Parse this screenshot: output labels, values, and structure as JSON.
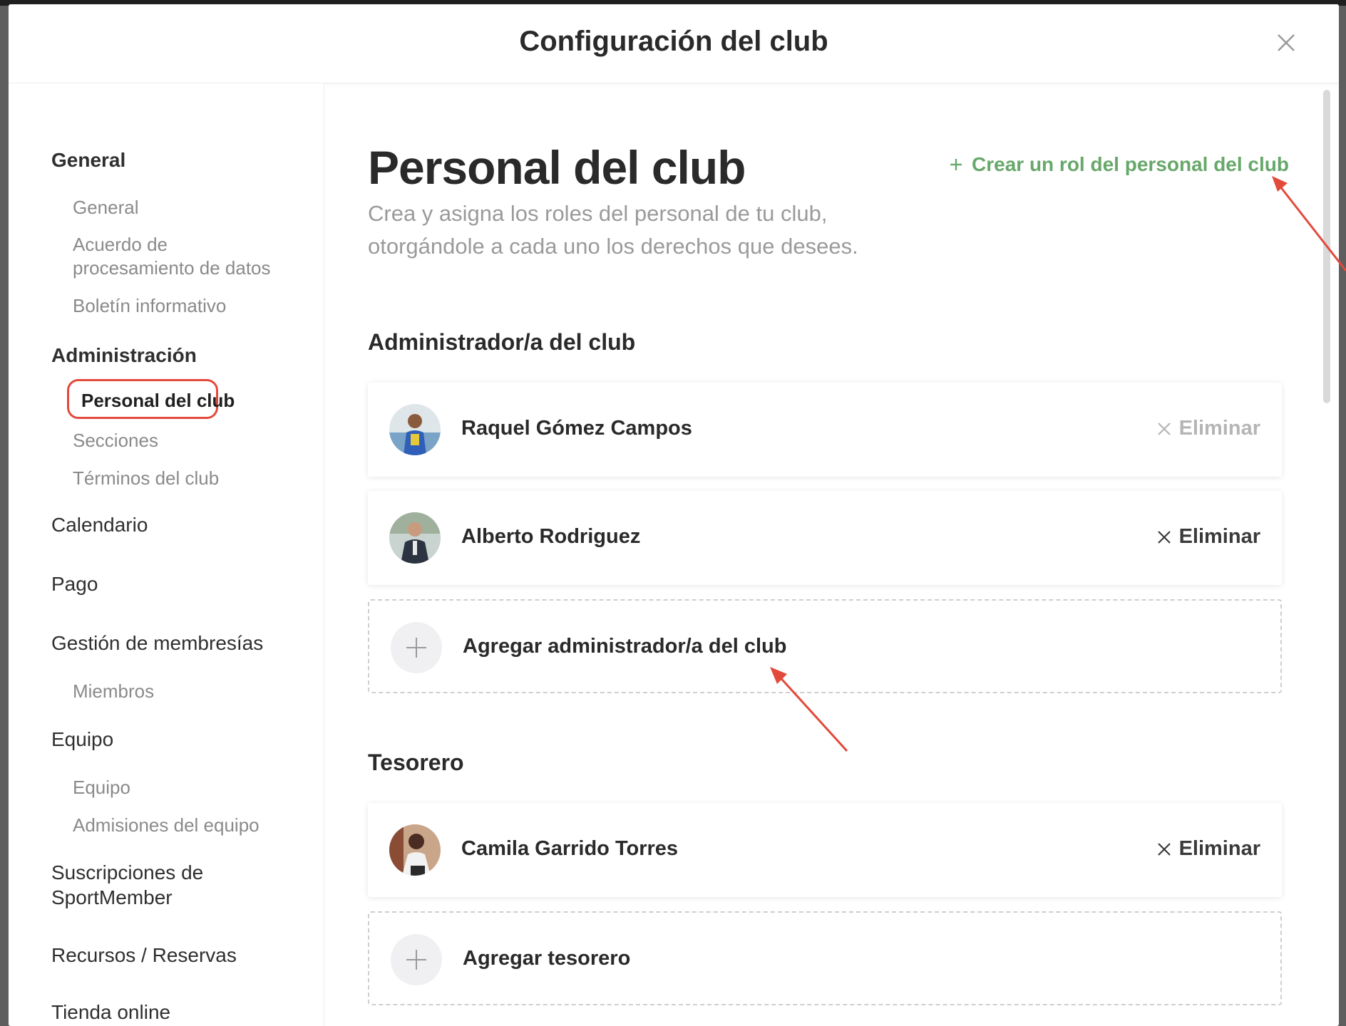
{
  "modal": {
    "title": "Configuración del club"
  },
  "sidebar": {
    "groups": [
      {
        "label": "General",
        "items": [
          "General",
          "Acuerdo de\nprocesamiento de datos",
          "Boletín informativo"
        ]
      },
      {
        "label": "Administración",
        "items": [
          "Personal del club",
          "Secciones",
          "Términos del club"
        ]
      }
    ],
    "general_label": "General",
    "general_item_1": "General",
    "general_item_2_line1": "Acuerdo de",
    "general_item_2_line2": "procesamiento de datos",
    "general_item_3": "Boletín informativo",
    "admin_label": "Administración",
    "admin_item_active": "Personal del club",
    "admin_item_2": "Secciones",
    "admin_item_3": "Términos del club",
    "calendario": "Calendario",
    "pago": "Pago",
    "membresias": "Gestión de membresías",
    "miembros": "Miembros",
    "equipo_group": "Equipo",
    "equipo_item": "Equipo",
    "admisiones": "Admisiones del equipo",
    "suscripciones_line1": "Suscripciones de",
    "suscripciones_line2": "SportMember",
    "recursos": "Recursos / Reservas",
    "tienda": "Tienda online"
  },
  "main": {
    "title": "Personal del club",
    "description": "Crea y asigna los roles del personal de tu club, otorgándole a cada uno los derechos que desees.",
    "create_role_label": "Crear un rol del personal del club",
    "sections": [
      {
        "title": "Administrador/a del club",
        "members": [
          {
            "name": "Raquel Gómez Campos",
            "remove_label": "Eliminar",
            "remove_enabled": false
          },
          {
            "name": "Alberto Rodriguez",
            "remove_label": "Eliminar",
            "remove_enabled": true
          }
        ],
        "add_label": "Agregar administrador/a del club"
      },
      {
        "title": "Tesorero",
        "members": [
          {
            "name": "Camila Garrido Torres",
            "remove_label": "Eliminar",
            "remove_enabled": true
          }
        ],
        "add_label": "Agregar tesorero"
      }
    ]
  },
  "colors": {
    "accent_green": "#67a86a",
    "highlight_red": "#e24a3b"
  }
}
